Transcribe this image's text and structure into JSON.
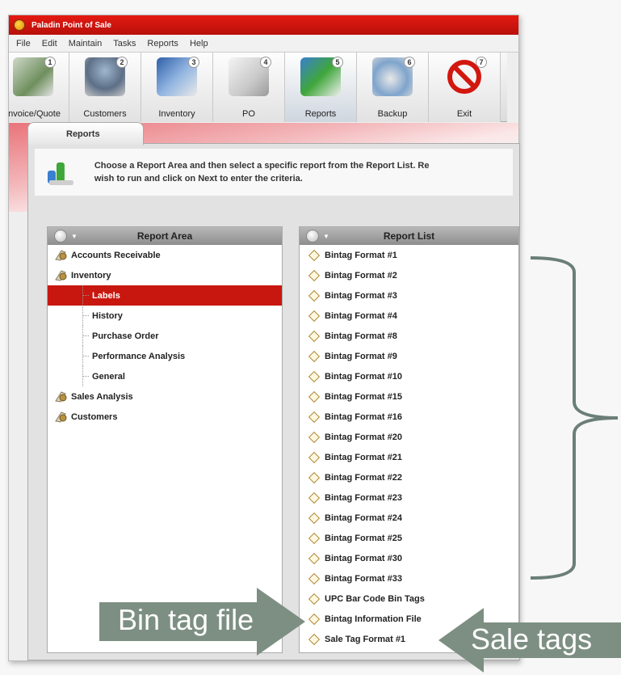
{
  "app": {
    "title": "Paladin Point of Sale"
  },
  "menu": [
    "File",
    "Edit",
    "Maintain",
    "Tasks",
    "Reports",
    "Help"
  ],
  "toolbar": [
    {
      "label": "Invoice/Quote",
      "num": "1",
      "icon": "calculator-icon"
    },
    {
      "label": "Customers",
      "num": "2",
      "icon": "customers-icon"
    },
    {
      "label": "Inventory",
      "num": "3",
      "icon": "inventory-icon"
    },
    {
      "label": "PO",
      "num": "4",
      "icon": "po-icon"
    },
    {
      "label": "Reports",
      "num": "5",
      "icon": "reports-icon"
    },
    {
      "label": "Backup",
      "num": "6",
      "icon": "backup-icon"
    },
    {
      "label": "Exit",
      "num": "7",
      "icon": "exit-icon"
    }
  ],
  "tab": {
    "label": "Reports"
  },
  "info": {
    "line1": "Choose a Report Area and then select a specific report from the Report List. Re",
    "line2": "wish to run and click on Next to enter the criteria."
  },
  "report_area": {
    "title": "Report Area",
    "items": [
      {
        "label": "Accounts Receivable",
        "level": 0
      },
      {
        "label": "Inventory",
        "level": 0
      },
      {
        "label": "Labels",
        "level": 1,
        "selected": true
      },
      {
        "label": "History",
        "level": 1
      },
      {
        "label": "Purchase Order",
        "level": 1
      },
      {
        "label": "Performance Analysis",
        "level": 1
      },
      {
        "label": "General",
        "level": 1
      },
      {
        "label": "Sales Analysis",
        "level": 0
      },
      {
        "label": "Customers",
        "level": 0
      }
    ]
  },
  "report_list": {
    "title": "Report List",
    "items": [
      "Bintag Format #1",
      "Bintag Format #2",
      "Bintag Format #3",
      "Bintag Format #4",
      "Bintag Format #8",
      "Bintag Format #9",
      "Bintag Format #10",
      "Bintag Format #15",
      "Bintag Format #16",
      "Bintag Format #20",
      "Bintag Format #21",
      "Bintag Format #22",
      "Bintag Format #23",
      "Bintag Format #24",
      "Bintag Format #25",
      "Bintag Format #30",
      "Bintag Format #33",
      "UPC Bar Code Bin Tags",
      "Bintag Information File",
      "Sale Tag Format #1"
    ]
  },
  "annotations": {
    "bin_tag": "Bin tag file",
    "sale_tags": "Sale tags",
    "arrow_color": "#7d8f82",
    "brace_color": "#6b7e78"
  }
}
